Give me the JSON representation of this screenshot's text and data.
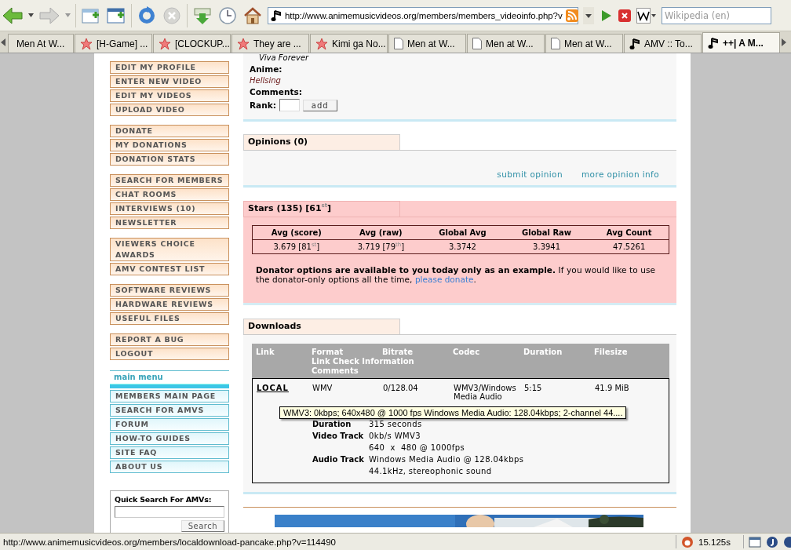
{
  "browser": {
    "url": "http://www.animemusicvideos.org/members/members_videoinfo.php?v",
    "search_placeholder": "Wikipedia (en)",
    "tabs": [
      {
        "label": "Men At W...",
        "kind": "plain",
        "selected": false
      },
      {
        "label": "[H-Game] ...",
        "kind": "star",
        "selected": false
      },
      {
        "label": "[CLOCKUP...",
        "kind": "star",
        "selected": false
      },
      {
        "label": "They are ...",
        "kind": "star",
        "selected": false
      },
      {
        "label": "Kimi ga No...",
        "kind": "star",
        "selected": false
      },
      {
        "label": "Men at W...",
        "kind": "page",
        "selected": false
      },
      {
        "label": "Men at W...",
        "kind": "page",
        "selected": false
      },
      {
        "label": "Men at W...",
        "kind": "page",
        "selected": false
      },
      {
        "label": "AMV :: To...",
        "kind": "music",
        "selected": false
      },
      {
        "label": "++| A M...",
        "kind": "music",
        "selected": true
      }
    ]
  },
  "sidebar": {
    "groups": [
      [
        "EDIT MY PROFILE",
        "ENTER NEW VIDEO",
        "EDIT MY VIDEOS",
        "UPLOAD VIDEO"
      ],
      [
        "DONATE",
        "MY DONATIONS",
        "DONATION STATS"
      ],
      [
        "SEARCH FOR MEMBERS",
        "CHAT ROOMS",
        "INTERVIEWS (10)",
        "NEWSLETTER"
      ],
      [
        "VIEWERS CHOICE AWARDS",
        "AMV CONTEST LIST"
      ],
      [
        "SOFTWARE REVIEWS",
        "HARDWARE REVIEWS",
        "USEFUL FILES"
      ],
      [
        "REPORT A BUG",
        "LOGOUT"
      ]
    ],
    "main_menu": {
      "title": "main menu",
      "items": [
        "MEMBERS MAIN PAGE",
        "SEARCH FOR AMVS",
        "FORUM",
        "HOW-TO GUIDES",
        "SITE FAQ",
        "ABOUT US"
      ]
    },
    "quick_search": {
      "title": "Quick Search For AMVs:",
      "button": "Search"
    }
  },
  "video_info": {
    "song": "Viva Forever",
    "anime_label": "Anime:",
    "anime": "Hellsing",
    "comments_label": "Comments:",
    "rank_label": "Rank:",
    "add_button": "add"
  },
  "opinions": {
    "title": "Opinions (0)",
    "links": [
      "submit opinion",
      "more opinion info"
    ]
  },
  "stars": {
    "title": "Stars (135) [61$^{st}$]",
    "columns": [
      "Avg (score)",
      "Avg (raw)",
      "Global Avg",
      "Global Raw",
      "Avg Count"
    ],
    "values": [
      "3.679 [81$^{st}$]",
      "3.719 [79$^{th}$]",
      "3.3742",
      "3.3941",
      "47.5261"
    ],
    "note": "**Donator options are available to you today only as an example.** If you would like to use the donator-only options all the time, ",
    "note_link": "please donate",
    "note_end": "."
  },
  "downloads": {
    "title": "Downloads",
    "columns": [
      "Link",
      "Format",
      "Bitrate",
      "Codec",
      "Duration",
      "Filesize"
    ],
    "subheaders": [
      "Link Check Information",
      "Comments"
    ],
    "row": [
      "LOCAL",
      "WMV",
      "0/128.04",
      "WMV3/Windows Media Audio",
      "5:15",
      "41.9 MiB"
    ],
    "details": [
      {
        "label": "Duration",
        "values": [
          "315 seconds"
        ]
      },
      {
        "label": "Video Track",
        "values": [
          "0kb/s WMV3",
          "640  x  480 @ 1000fps"
        ]
      },
      {
        "label": "Audio Track",
        "values": [
          "Windows Media Audio @ 128.04kbps",
          "44.1kHz, stereophonic sound"
        ]
      }
    ],
    "tooltip": "WMV3: 0kbps; 640x480 @ 1000 fps Windows Media Audio: 128.04kbps; 2-channel 44...."
  },
  "status_bar": {
    "url": "http://www.animemusicvideos.org/members/localdownload-pancake.php?v=114490",
    "timer": "15.125s"
  }
}
